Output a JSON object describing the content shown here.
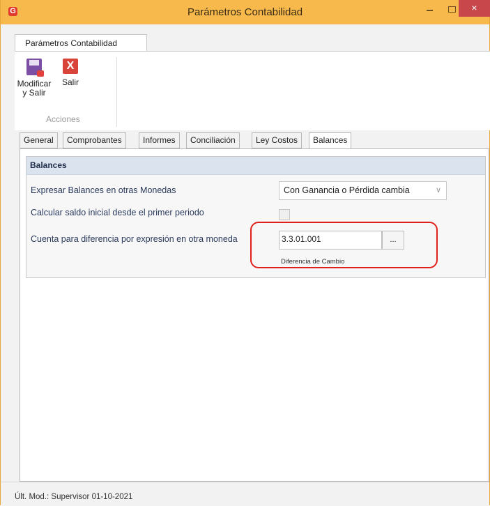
{
  "window": {
    "title": "Parámetros Contabilidad",
    "app_icon": "G",
    "close_glyph": "×"
  },
  "ribbon": {
    "tab_label": "Parámetros Contabilidad",
    "buttons": {
      "save_exit_line1": "Modificar",
      "save_exit_line2": "y Salir",
      "exit_label": "Salir",
      "exit_glyph": "X"
    },
    "group_label": "Acciones"
  },
  "tabs": [
    {
      "label": "General"
    },
    {
      "label": "Comprobantes"
    },
    {
      "label": "Informes"
    },
    {
      "label": "Conciliación"
    },
    {
      "label": "Ley Costos"
    },
    {
      "label": "Balances",
      "active": true
    }
  ],
  "balances": {
    "header": "Balances",
    "row1_label": "Expresar Balances en otras Monedas",
    "currency_option": "Con Ganancia o Pérdida cambia",
    "row2_label": "Calcular saldo inicial desde el primer periodo",
    "initial_balance_checked": false,
    "row3_label": "Cuenta para diferencia por expresión en otra moneda",
    "account_code": "3.3.01.001",
    "lookup_button": "...",
    "account_description": "Diferencia de Cambio"
  },
  "status": {
    "text": "Últ. Mod.: Supervisor 01-10-2021"
  },
  "colors": {
    "titlebar": "#f7b84c",
    "close": "#c7474a",
    "highlight": "#e0201b",
    "group_header": "#dbe3ee"
  }
}
